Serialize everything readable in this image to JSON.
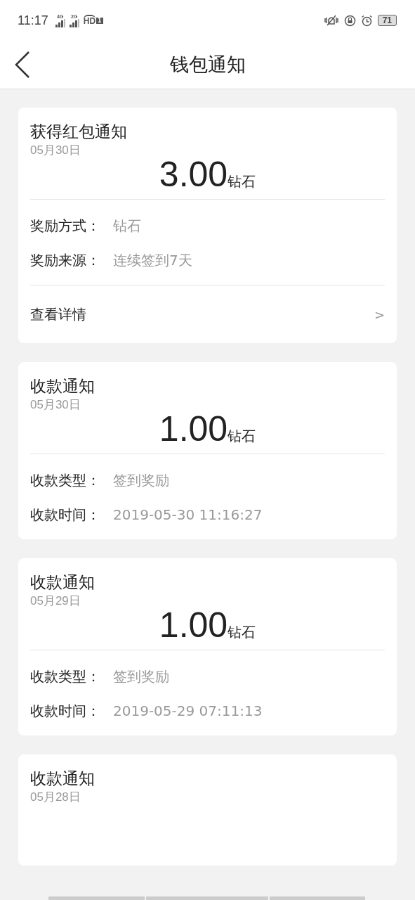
{
  "status_bar": {
    "time": "11:17",
    "network_1": "4G",
    "network_2": "2G",
    "hd": "HD",
    "sim": "1",
    "battery": "71"
  },
  "header": {
    "title": "钱包通知"
  },
  "cards": [
    {
      "kind": "reward",
      "title": "获得红包通知",
      "date": "05月30日",
      "amount": "3.00",
      "unit": "钻石",
      "rows": [
        {
          "label": "奖励方式：",
          "value": "钻石"
        },
        {
          "label": "奖励来源：",
          "value": "连续签到7天"
        }
      ],
      "link": {
        "label": "查看详情",
        "arrow": ">"
      }
    },
    {
      "kind": "payment",
      "title": "收款通知",
      "date": "05月30日",
      "amount": "1.00",
      "unit": "钻石",
      "rows": [
        {
          "label": "收款类型：",
          "value": "签到奖励"
        },
        {
          "label": "收款时间：",
          "value": "2019-05-30 11:16:27"
        }
      ]
    },
    {
      "kind": "payment",
      "title": "收款通知",
      "date": "05月29日",
      "amount": "1.00",
      "unit": "钻石",
      "rows": [
        {
          "label": "收款类型：",
          "value": "签到奖励"
        },
        {
          "label": "收款时间：",
          "value": "2019-05-29 07:11:13"
        }
      ]
    },
    {
      "kind": "partial",
      "title": "收款通知",
      "date": "05月28日"
    }
  ]
}
